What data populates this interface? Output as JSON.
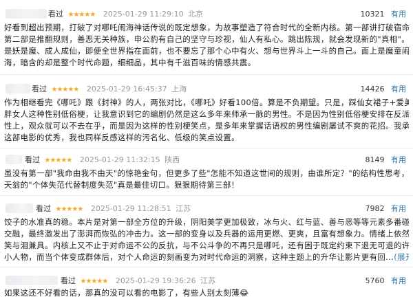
{
  "reviews": [
    {
      "status": "看过",
      "stars": "★★★★★",
      "time": "2025-01-29 11:29:10",
      "location": "北京",
      "votes": "10321",
      "useful_label": "有用",
      "lines": [
        "好看到超出预期，打破了对哪吒闹海神话传说的既定想象，为故事塑造了符合时代的全新内核。第一部讲打破宿命，",
        "第二部是推翻规则，善恶无关种族，申公豹有自己的坚守与珍视，仙人有私心。跳出陈规，就会发现新的\"真相\"。无论",
        "是妖是魔、成人成仙，即便全世界指在面前，也不要忘了那个心中有火、想与世界斗上一斗的自己。面上是魔童闹",
        "海，暗含的却是整个时代命题，细细品，其中有千滋百味的情感共震。"
      ]
    },
    {
      "status": "看过",
      "stars": "★★★★★",
      "time": "2025-01-29 16:45:37",
      "location": "上海",
      "votes": "14426",
      "useful_label": "有用",
      "lines": [
        "作为相继看完《哪吒》跟《封神》的人，两张对比，《哪吒》好看100倍。算是不负期望。只是，踩仙女裙子+爱美的",
        "胖女人这种性别低俗梗，让我意识到它的编剧仍然是这么多年来师承一脉的男性。不是因为性别低俗梗安排在反派女",
        "性上，观众就可以不去在乎，而是因为这样的性别梗笑点，是多年来掌握话语权的男性编剧屡试不爽的花招。我承认",
        "这部电影的优秀，我也同样反感这样的污名化、低级的笑点设置。"
      ]
    },
    {
      "status": "看过",
      "stars": "★★★★★",
      "time": "2025-01-29 11:32:15",
      "location": "陕西",
      "votes": "8149",
      "useful_label": "有用",
      "lines": [
        "虽没有第一部\"我命由我不由天\"的惊艳金句，但更多了些\"怎能不知道这世间的规则，由谁所定？\"的结构性思考，无量",
        "天翁的\"个体失范代替制度失范\"真是最佳切口。狠狠期待第三部！"
      ]
    },
    {
      "status": "看过",
      "stars": "★★★★★",
      "time": "2025-01-29 11:28:51",
      "location": "江苏",
      "votes": "7982",
      "useful_label": "有用",
      "lines": [
        "饺子的水准真的稳。本片是对第一部全方位的升级，阴阳美学更加极致，冰与火、红与蓝、善与恶等等元素多番碰撞与",
        "交融，最终激发出了澎湃而恢弘的冲击力。这一部的变身以及兵器的运用更燃、更爽，且富有想象力。情绪上依然是",
        "笑与泪兼具。内核上又不止于对命运不公的反抗，与不公斗争的不再只是哪吒，还有困于既定约束下退无可退的许多",
        "小人物，而当个体变成群体后，对个人命运的刻画变为对时代命运的洞察，这种主题上的升华让影片更有回..."
      ],
      "expand_label": "(展开)"
    },
    {
      "status": "看过",
      "stars": "★★★★★",
      "time": "2025-01-29 19:36:26",
      "location": "江苏",
      "votes": "5760",
      "useful_label": "有用",
      "lines": [
        "如果这还不好看的话，那真的没可以看的电影了，有些人别太刻薄😂"
      ]
    }
  ]
}
